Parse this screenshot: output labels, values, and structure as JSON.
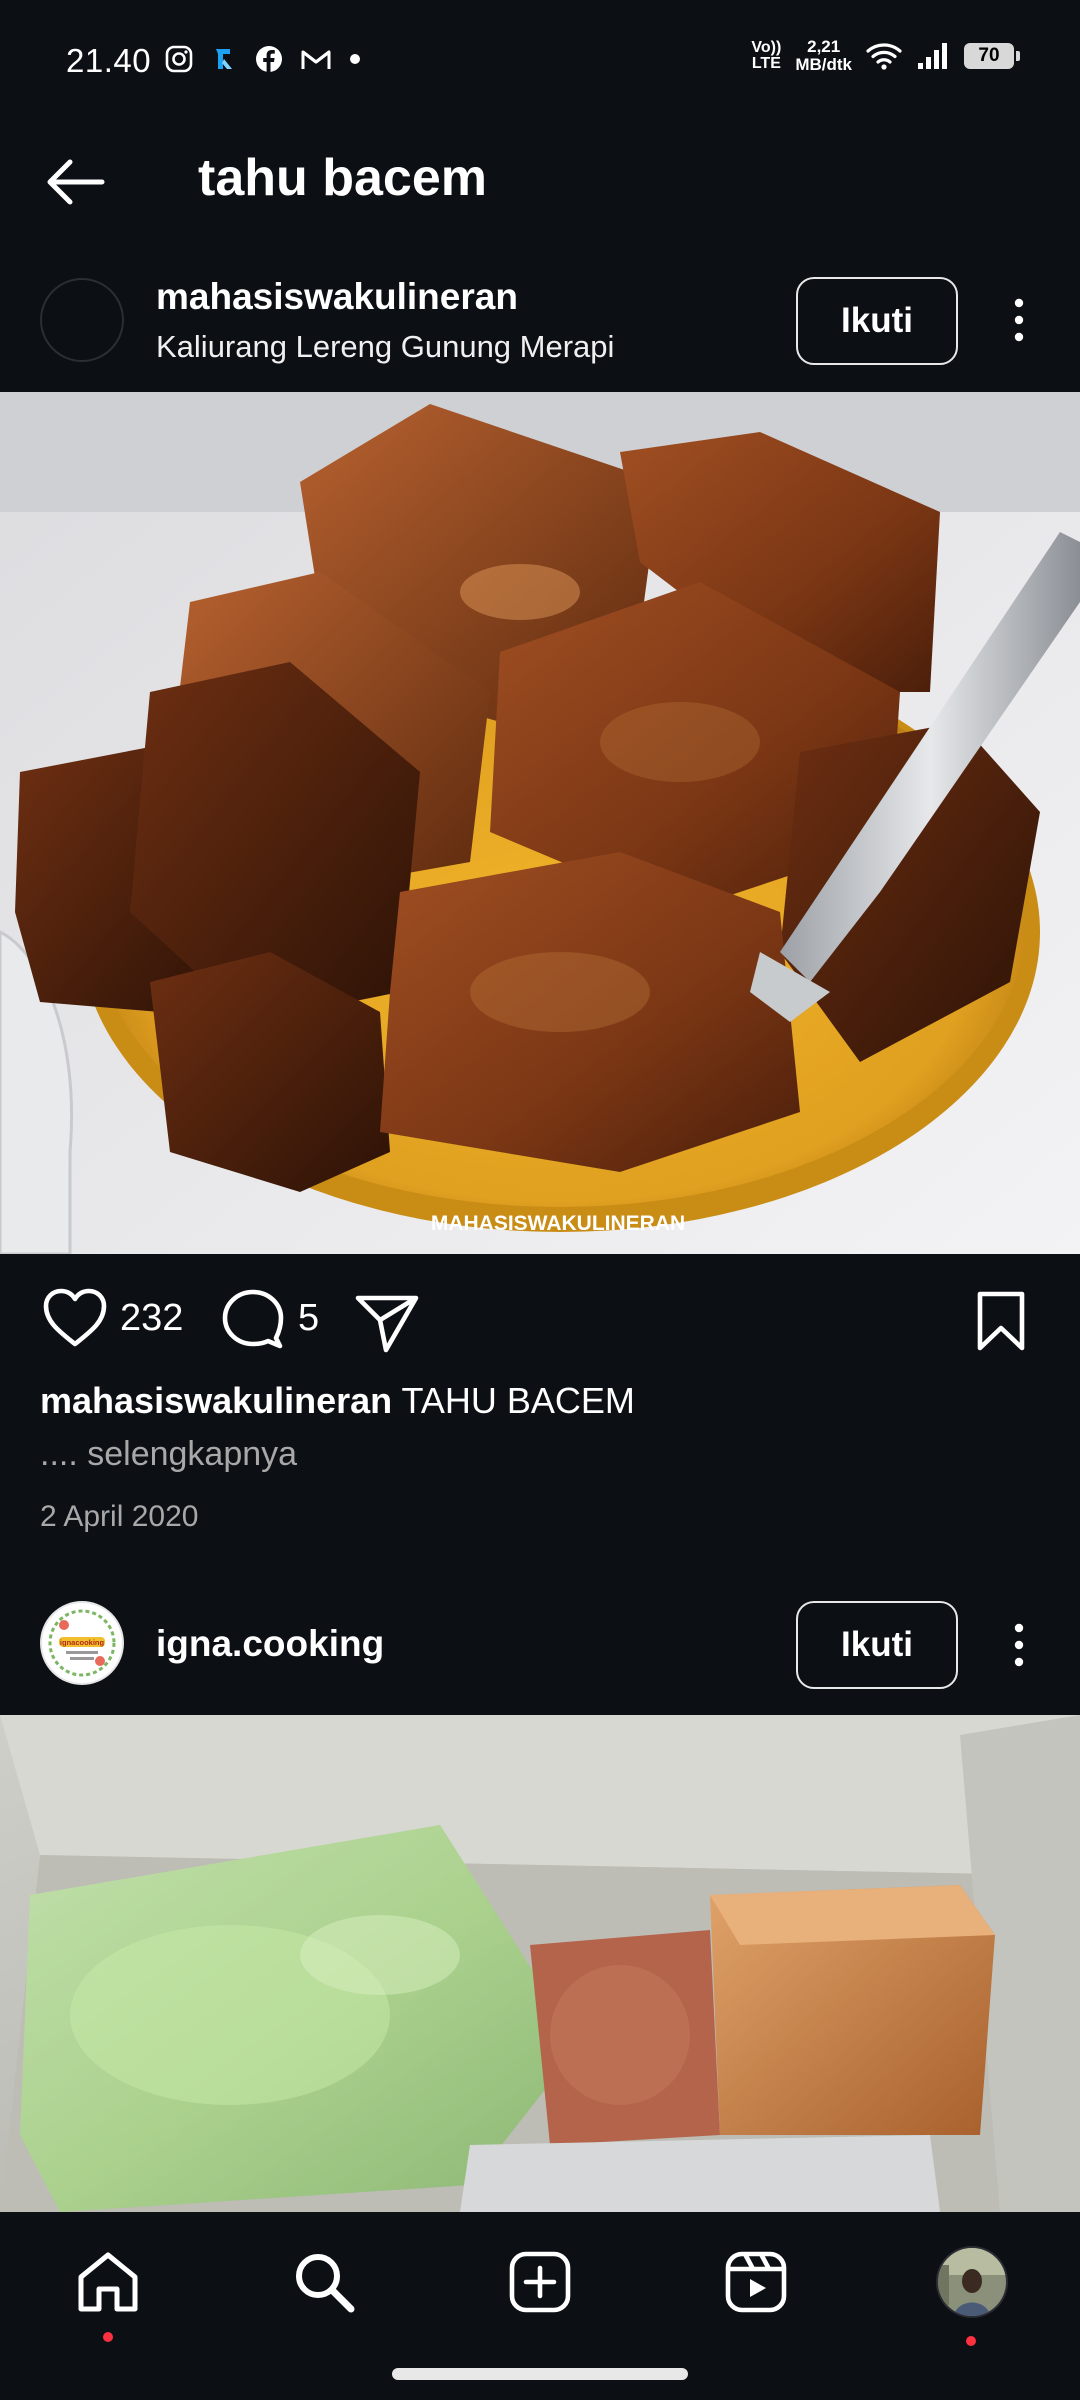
{
  "status_bar": {
    "time": "21.40",
    "left_icons": [
      "instagram-icon",
      "app-icon",
      "facebook-icon",
      "gmail-icon",
      "dot-icon"
    ],
    "volte_line1": "Vo))",
    "volte_line2": "LTE",
    "speed_value": "2,21",
    "speed_unit": "MB/dtk",
    "battery": "70"
  },
  "header": {
    "back_icon": "arrow-left-icon",
    "title": "tahu bacem"
  },
  "posts": [
    {
      "username": "mahasiswakulineran",
      "location": "Kaliurang Lereng Gunung Merapi",
      "follow_label": "Ikuti",
      "watermark": "MAHASISWAKULINERAN",
      "likes": "232",
      "comments": "5",
      "caption_user": "mahasiswakulineran",
      "caption_text": "TAHU BACEM",
      "more_label": ".... selengkapnya",
      "date": "2 April 2020"
    },
    {
      "username": "igna.cooking",
      "avatar_text": "ignacooking",
      "follow_label": "Ikuti"
    }
  ],
  "bottom_nav": {
    "items": [
      "home-icon",
      "search-icon",
      "create-icon",
      "reels-icon",
      "profile-avatar"
    ]
  },
  "colors": {
    "background": "#0c0f14",
    "notification_dot": "#ff3040",
    "secondary_text": "#a8a8a8"
  }
}
